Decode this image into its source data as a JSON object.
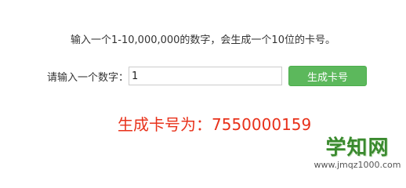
{
  "instruction": "输入一个1-10,000,000的数字，会生成一个10位的卡号。",
  "form": {
    "label": "请输入一个数字：",
    "input_value": "1",
    "button_label": "生成卡号"
  },
  "result": {
    "text": "生成卡号为：7550000159"
  },
  "watermark": {
    "title": "学知网",
    "url": "www.jmqz1000.com"
  }
}
